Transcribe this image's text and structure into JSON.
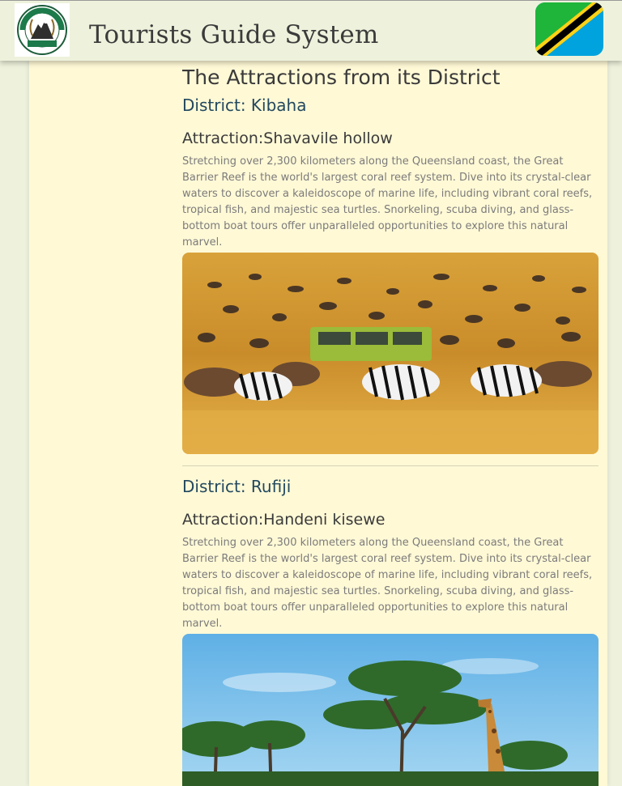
{
  "header": {
    "site_title": "Tourists Guide System",
    "logo_text_top": "UTALII",
    "logo_text_bottom": "CHUMBANI"
  },
  "main": {
    "heading": "The Attractions from its District",
    "entries": [
      {
        "district": "District: Kibaha",
        "attraction": "Attraction:Shavavile hollow",
        "description": "Stretching over 2,300 kilometers along the Queensland coast, the Great Barrier Reef is the world's largest coral reef system. Dive into its crystal-clear waters to discover a kaleidoscope of marine life, including vibrant coral reefs, tropical fish, and majestic sea turtles. Snorkeling, scuba diving, and glass-bottom boat tours offer unparalleled opportunities to explore this natural marvel.",
        "image": "safari-wildebeest-zebras-photo"
      },
      {
        "district": "District: Rufiji",
        "attraction": "Attraction:Handeni kisewe",
        "description": "Stretching over 2,300 kilometers along the Queensland coast, the Great Barrier Reef is the world's largest coral reef system. Dive into its crystal-clear waters to discover a kaleidoscope of marine life, including vibrant coral reefs, tropical fish, and majestic sea turtles. Snorkeling, scuba diving, and glass-bottom boat tours offer unparalleled opportunities to explore this natural marvel.",
        "image": "acacia-giraffe-photo"
      }
    ]
  },
  "colors": {
    "background": "#eef2dc",
    "panel": "#fff9d6",
    "district_text": "#23485e",
    "flag_green": "#1eb53a",
    "flag_blue": "#00a3dd",
    "flag_yellow": "#fcd116",
    "flag_black": "#000000"
  }
}
